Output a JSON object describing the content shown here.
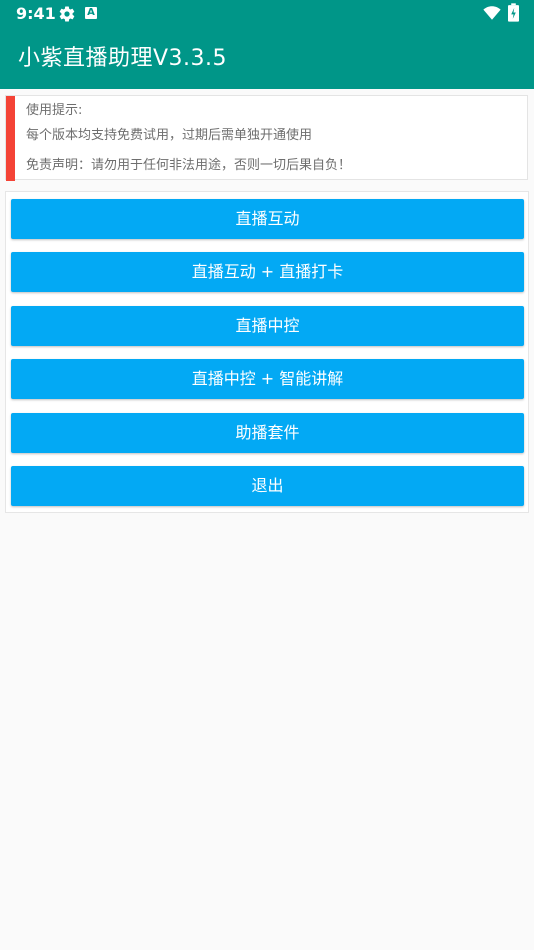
{
  "status_bar": {
    "time": "9:41",
    "icons": [
      "gear-icon",
      "a-icon",
      "wifi-icon",
      "battery-icon"
    ]
  },
  "app": {
    "title": "小紫直播助理V3.3.5"
  },
  "notice": {
    "heading": "使用提示:",
    "line1": "每个版本均支持免费试用，过期后需单独开通使用",
    "line2": "免责声明：请勿用于任何非法用途，否则一切后果自负！"
  },
  "buttons": [
    {
      "label": "直播互动"
    },
    {
      "label": "直播互动 + 直播打卡"
    },
    {
      "label": "直播中控"
    },
    {
      "label": "直播中控 + 智能讲解"
    },
    {
      "label": "助播套件"
    },
    {
      "label": "退出"
    }
  ],
  "colors": {
    "toolbar": "#009688",
    "accent_bar": "#f44336",
    "button": "#03a9f4",
    "background": "#fafafa"
  }
}
